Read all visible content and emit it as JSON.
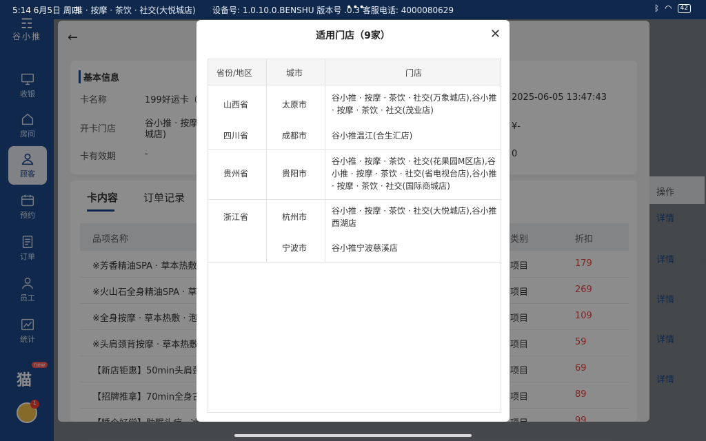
{
  "statusbar": {
    "time": "5:14  6月5日 周四",
    "store": "推 · 按摩 · 茶饮 · 社交(大悦城店)",
    "device": "设备号: 1.0.10.0.BENSHU   版本号  .0.3   客服电话:  4000080629",
    "battery": "42"
  },
  "sidebar": {
    "logo_text": "谷小推",
    "items": [
      {
        "label": "收银",
        "icon": "monitor-icon"
      },
      {
        "label": "房间",
        "icon": "home-icon"
      },
      {
        "label": "顾客",
        "icon": "user-icon"
      },
      {
        "label": "预约",
        "icon": "calendar-icon"
      },
      {
        "label": "订单",
        "icon": "order-icon"
      },
      {
        "label": "员工",
        "icon": "staff-icon"
      },
      {
        "label": "统计",
        "icon": "chart-icon"
      }
    ],
    "new_badge": "new",
    "avatar_count": "1"
  },
  "info": {
    "title": "基本信息",
    "card_name_label": "卡名称",
    "card_name_value": "199好运卡（谷",
    "open_store_label": "开卡门店",
    "open_store_value_1": "谷小推 · 按摩 ·",
    "open_store_value_2": "城店)",
    "validity_label": "卡有效期",
    "validity_value": "-",
    "right_time": "2025-06-05 13:47:43",
    "right_amount": "¥-",
    "right_zero": "0"
  },
  "content": {
    "tab_active": "卡内容",
    "tab_other": "订单记录",
    "col_name": "品项名称",
    "col_type": "类别",
    "col_discount": "折扣",
    "col_action": "操作",
    "rows": [
      {
        "name": "※芳香精油SPA · 草本热敷 ·",
        "type": "项目",
        "discount": "179"
      },
      {
        "name": "※火山石全身精油SPA · 草本",
        "type": "项目",
        "discount": "269"
      },
      {
        "name": "※全身按摩 · 草本热敷 · 泡脚",
        "type": "项目",
        "discount": "109"
      },
      {
        "name": "※头肩颈背按摩 · 草本热敷",
        "type": "项目",
        "discount": "59"
      },
      {
        "name": "【新店钜惠】50min头肩颈",
        "type": "项目",
        "discount": "69"
      },
      {
        "name": "【招牌推拿】70min全身古",
        "type": "项目",
        "discount": "89"
      },
      {
        "name": "【睡个好觉】助眠头疗 · 冰",
        "type": "项目",
        "discount": "99"
      }
    ],
    "detail_label": "详情"
  },
  "modal": {
    "title": "适用门店（9家）",
    "close": "✕",
    "headers": {
      "province": "省份/地区",
      "city": "城市",
      "store": "门店"
    },
    "groups": [
      {
        "province": "山西省",
        "city": "太原市",
        "store_lines": [
          "谷小推 · 按摩 · 茶饮 · 社交(万象城店),谷小推",
          "· 按摩 · 茶饮 · 社交(茂业店)"
        ]
      },
      {
        "province": "四川省",
        "city": "成都市",
        "store_lines": [
          "谷小推温江(合生汇店)"
        ]
      },
      {
        "province": "贵州省",
        "city": "贵阳市",
        "store_lines": [
          "谷小推 · 按摩 · 茶饮 · 社交(花果园M区店),谷",
          "小推 · 按摩 · 茶饮 · 社交(省电视台店),谷小推",
          "· 按摩 · 茶饮 · 社交(国际商城店)"
        ]
      },
      {
        "province": "浙江省",
        "city": "杭州市",
        "store_lines": [
          "谷小推 · 按摩 · 茶饮 · 社交(大悦城店),谷小推",
          "西湖店"
        ]
      },
      {
        "province": "",
        "city": "宁波市",
        "store_lines": [
          "谷小推宁波慈溪店"
        ]
      }
    ]
  }
}
